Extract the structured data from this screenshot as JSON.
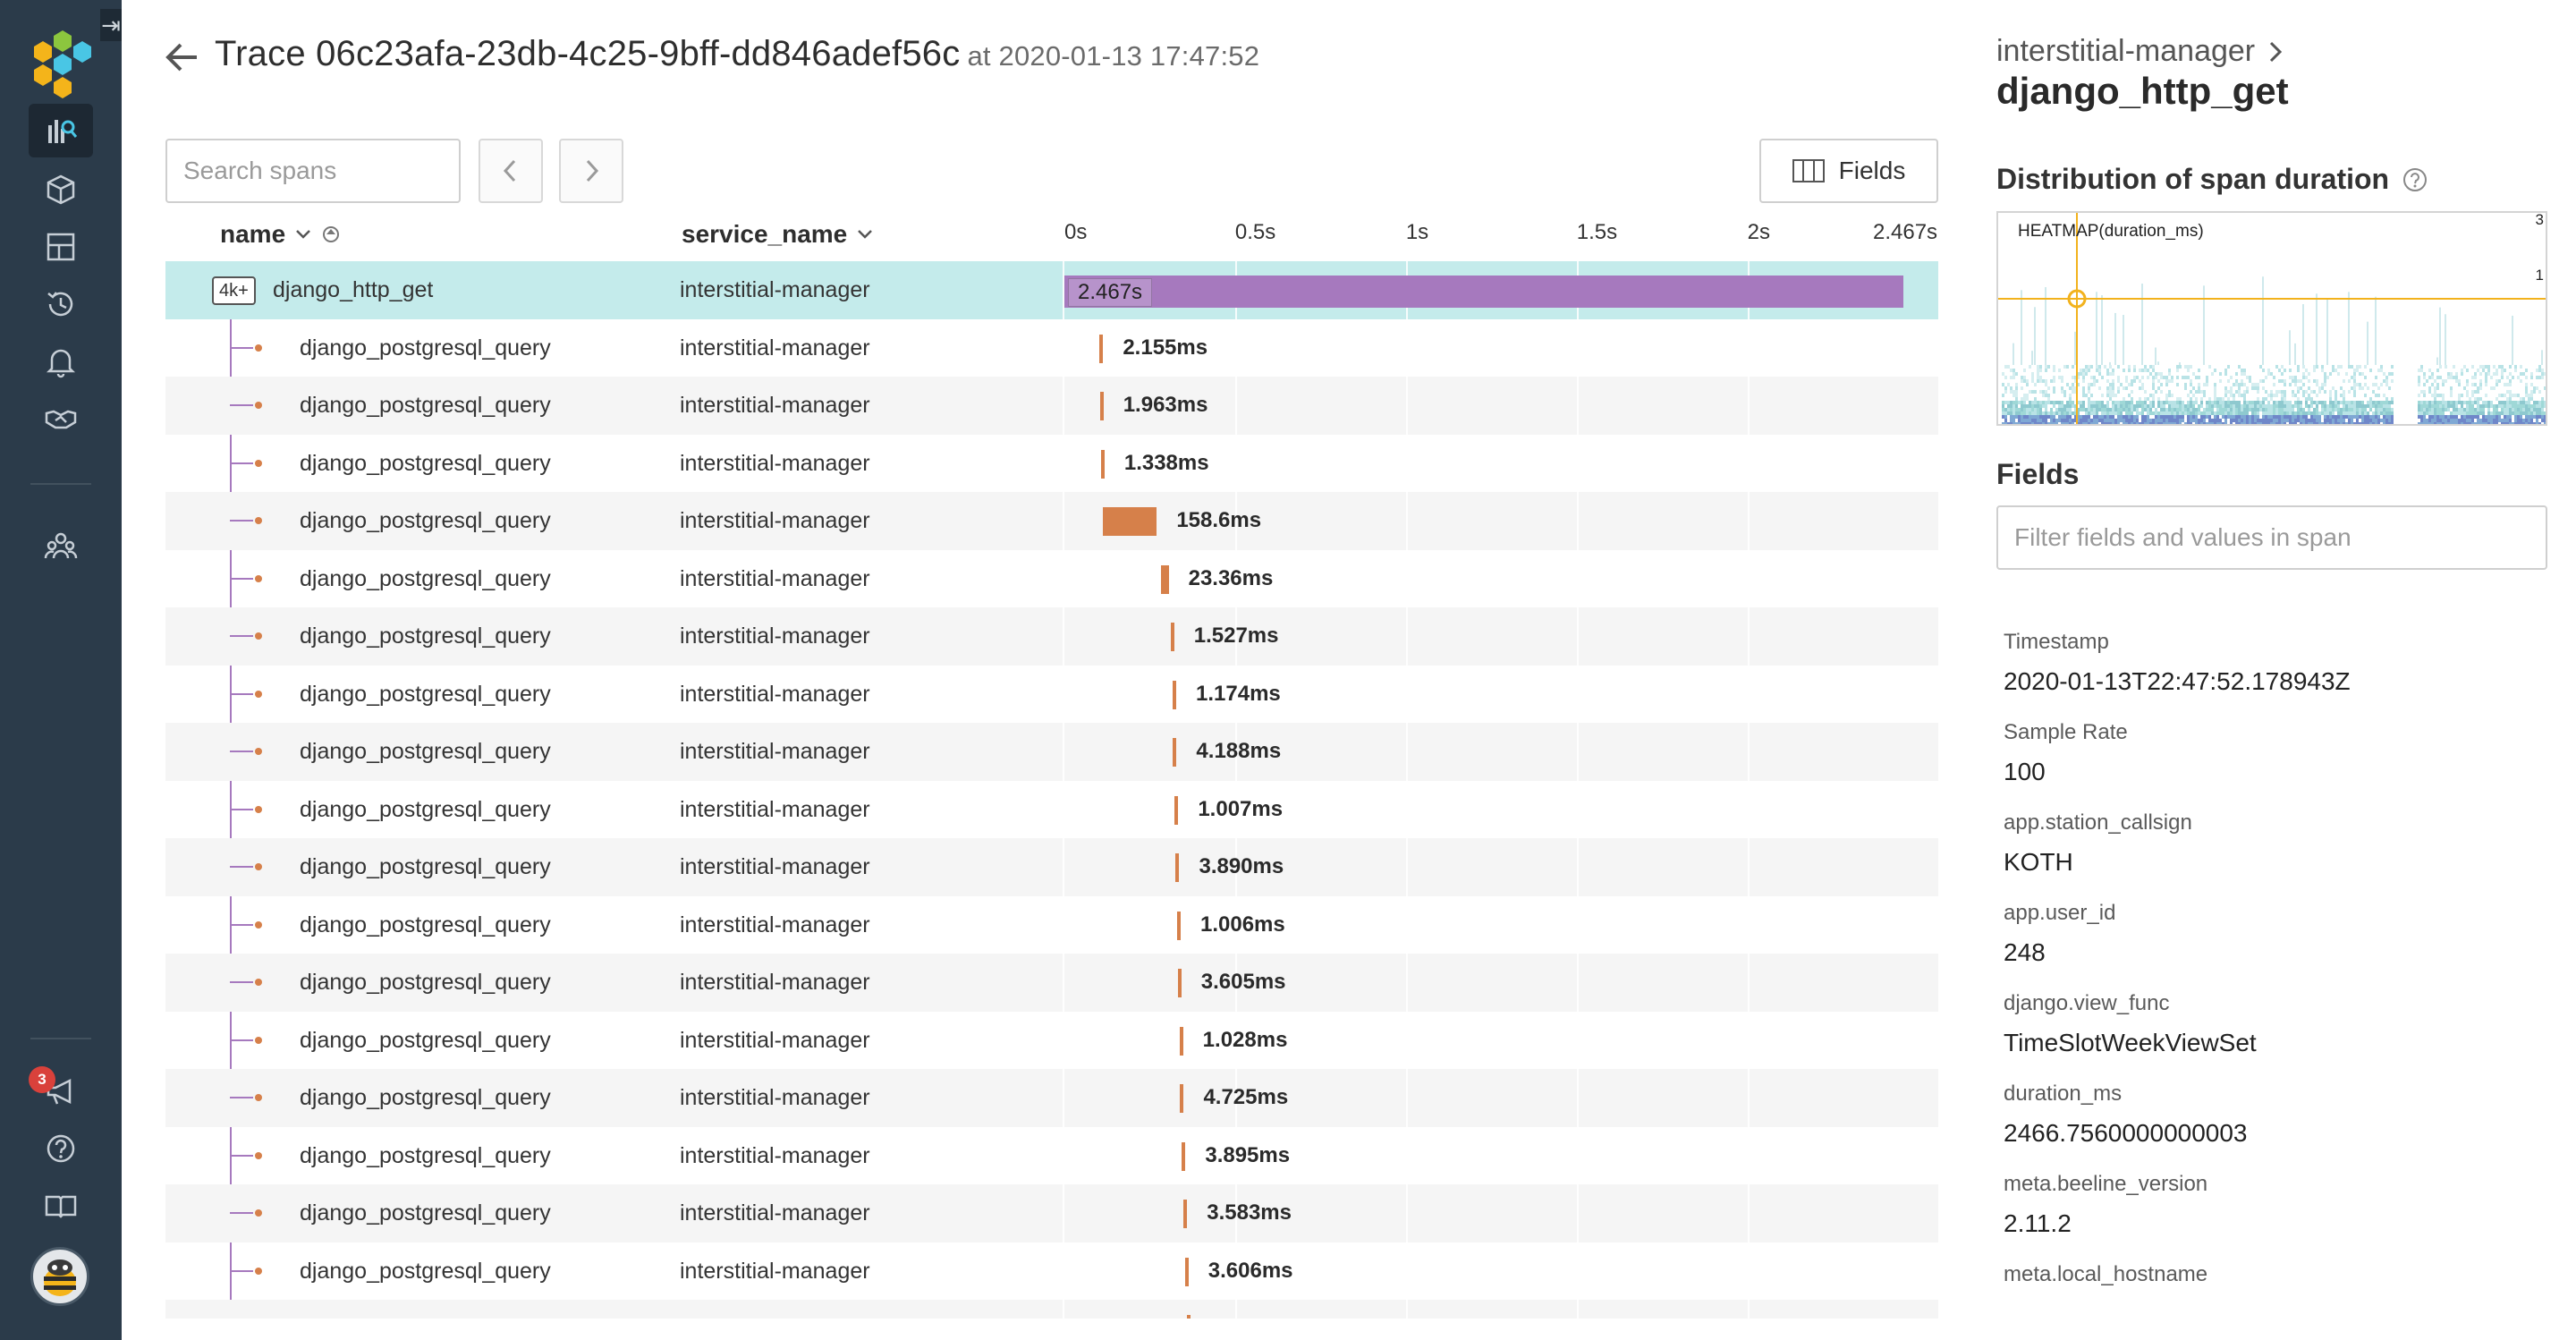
{
  "nav": {
    "items": [
      {
        "name": "query-icon",
        "active": true
      },
      {
        "name": "datasets-icon"
      },
      {
        "name": "boards-icon"
      },
      {
        "name": "history-icon"
      },
      {
        "name": "triggers-icon"
      },
      {
        "name": "slo-icon"
      },
      {
        "name": "team-icon"
      },
      {
        "name": "announcements-icon"
      },
      {
        "name": "help-icon"
      },
      {
        "name": "docs-icon"
      }
    ],
    "notification_count": "3",
    "colors": {
      "bg": "#2b3b4a",
      "active": "#1d2833",
      "accent": "#49c6e5"
    }
  },
  "header": {
    "title": "Trace 06c23afa-23db-4c25-9bff-dd846adef56c",
    "at": "at 2020-01-13 17:47:52"
  },
  "toolbar": {
    "search_placeholder": "Search spans",
    "fields_label": "Fields"
  },
  "table": {
    "columns": {
      "name": "name",
      "service": "service_name"
    },
    "time_ticks": [
      "0s",
      "0.5s",
      "1s",
      "1.5s",
      "2s",
      "2.467s"
    ],
    "total_duration_s": 2.467,
    "root": {
      "count": "4k+",
      "name": "django_http_get",
      "service": "interstitial-manager",
      "duration": "2.467s",
      "start_s": 0,
      "duration_s": 2.467
    },
    "rows": [
      {
        "name": "django_postgresql_query",
        "service": "interstitial-manager",
        "duration": "2.155ms",
        "start_s": 0.103
      },
      {
        "name": "django_postgresql_query",
        "service": "interstitial-manager",
        "duration": "1.963ms",
        "start_s": 0.104
      },
      {
        "name": "django_postgresql_query",
        "service": "interstitial-manager",
        "duration": "1.338ms",
        "start_s": 0.107
      },
      {
        "name": "django_postgresql_query",
        "service": "interstitial-manager",
        "duration": "158.6ms",
        "start_s": 0.112
      },
      {
        "name": "django_postgresql_query",
        "service": "interstitial-manager",
        "duration": "23.36ms",
        "start_s": 0.282
      },
      {
        "name": "django_postgresql_query",
        "service": "interstitial-manager",
        "duration": "1.527ms",
        "start_s": 0.311
      },
      {
        "name": "django_postgresql_query",
        "service": "interstitial-manager",
        "duration": "1.174ms",
        "start_s": 0.317
      },
      {
        "name": "django_postgresql_query",
        "service": "interstitial-manager",
        "duration": "4.188ms",
        "start_s": 0.318
      },
      {
        "name": "django_postgresql_query",
        "service": "interstitial-manager",
        "duration": "1.007ms",
        "start_s": 0.323
      },
      {
        "name": "django_postgresql_query",
        "service": "interstitial-manager",
        "duration": "3.890ms",
        "start_s": 0.326
      },
      {
        "name": "django_postgresql_query",
        "service": "interstitial-manager",
        "duration": "1.006ms",
        "start_s": 0.33
      },
      {
        "name": "django_postgresql_query",
        "service": "interstitial-manager",
        "duration": "3.605ms",
        "start_s": 0.332
      },
      {
        "name": "django_postgresql_query",
        "service": "interstitial-manager",
        "duration": "1.028ms",
        "start_s": 0.337
      },
      {
        "name": "django_postgresql_query",
        "service": "interstitial-manager",
        "duration": "4.725ms",
        "start_s": 0.339
      },
      {
        "name": "django_postgresql_query",
        "service": "interstitial-manager",
        "duration": "3.895ms",
        "start_s": 0.344
      },
      {
        "name": "django_postgresql_query",
        "service": "interstitial-manager",
        "duration": "3.583ms",
        "start_s": 0.349
      },
      {
        "name": "django_postgresql_query",
        "service": "interstitial-manager",
        "duration": "3.606ms",
        "start_s": 0.353
      }
    ]
  },
  "panel": {
    "service": "interstitial-manager",
    "span_name": "django_http_get",
    "distribution_title": "Distribution of span duration",
    "heatmap_label": "HEATMAP(duration_ms)",
    "heatmap_y_ticks": [
      "3",
      "1"
    ],
    "fields_title": "Fields",
    "filter_placeholder": "Filter fields and values in span",
    "fields": [
      {
        "key": "Timestamp",
        "value": "2020-01-13T22:47:52.178943Z"
      },
      {
        "key": "Sample Rate",
        "value": "100"
      },
      {
        "key": "app.station_callsign",
        "value": "KOTH"
      },
      {
        "key": "app.user_id",
        "value": "248"
      },
      {
        "key": "django.view_func",
        "value": "TimeSlotWeekViewSet"
      },
      {
        "key": "duration_ms",
        "value": "2466.7560000000003"
      },
      {
        "key": "meta.beeline_version",
        "value": "2.11.2"
      },
      {
        "key": "meta.local_hostname",
        "value": ""
      }
    ]
  },
  "colors": {
    "root_bar": "#a679be",
    "child_bar": "#d6804a",
    "selected_row": "#c4ebeb"
  }
}
